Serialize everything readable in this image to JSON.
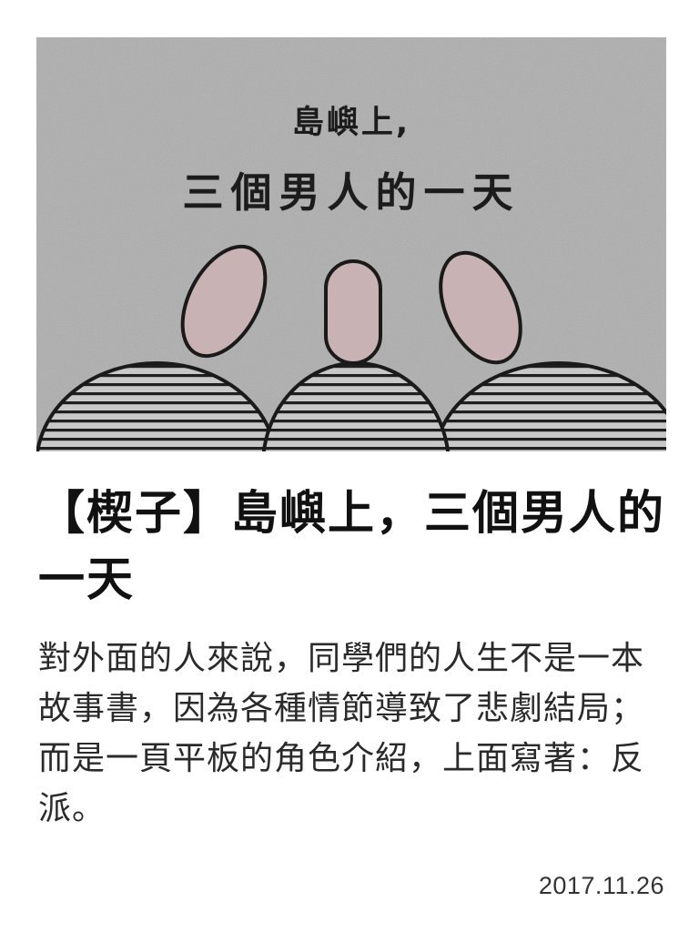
{
  "cover": {
    "line1": "島嶼上,",
    "line2": "三個男人的一天",
    "colors": {
      "background": "#b9b9b9",
      "head_fill": "#c9b2b3",
      "outline": "#1a1a1a"
    }
  },
  "article": {
    "title": "【楔子】島嶼上，三個男人的一天",
    "summary": "對外面的人來說，同學們的人生不是一本故事書，因為各種情節導致了悲劇結局；而是一頁平板的角色介紹，上面寫著：反派。",
    "date": "2017.11.26"
  }
}
